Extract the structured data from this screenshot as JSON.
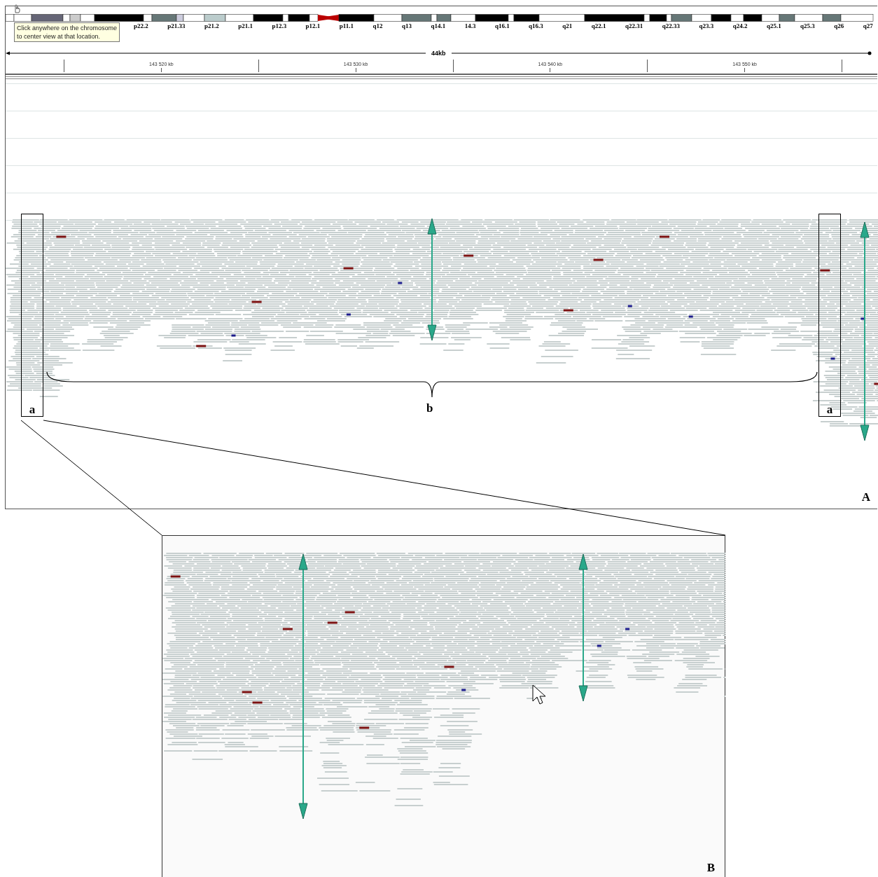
{
  "panel_a": {
    "ideogram": {
      "band_labels": [
        "p22.2",
        "p21.33",
        "p21.2",
        "p21.1",
        "p12.3",
        "p12.1",
        "p11.1",
        "q12",
        "q13",
        "q14.1",
        "14.3",
        "q16.1",
        "q16.3",
        "q21",
        "q22.1",
        "q22.31",
        "q22.33",
        "q23.3",
        "q24.2",
        "q25.1",
        "q25.3",
        "q26",
        "q27"
      ]
    },
    "tooltip": {
      "lines": [
        "Click anywhere on the chromosome",
        "to center view at that location."
      ]
    },
    "ruler": {
      "span": "44kb",
      "ticks": [
        "143 520 kb",
        "143 530 kb",
        "143 540 kb",
        "143 550 kb"
      ]
    },
    "annotations": [
      "a",
      "b",
      "a"
    ],
    "panel_label": "A"
  },
  "panel_b": {
    "panel_label": "B"
  }
}
